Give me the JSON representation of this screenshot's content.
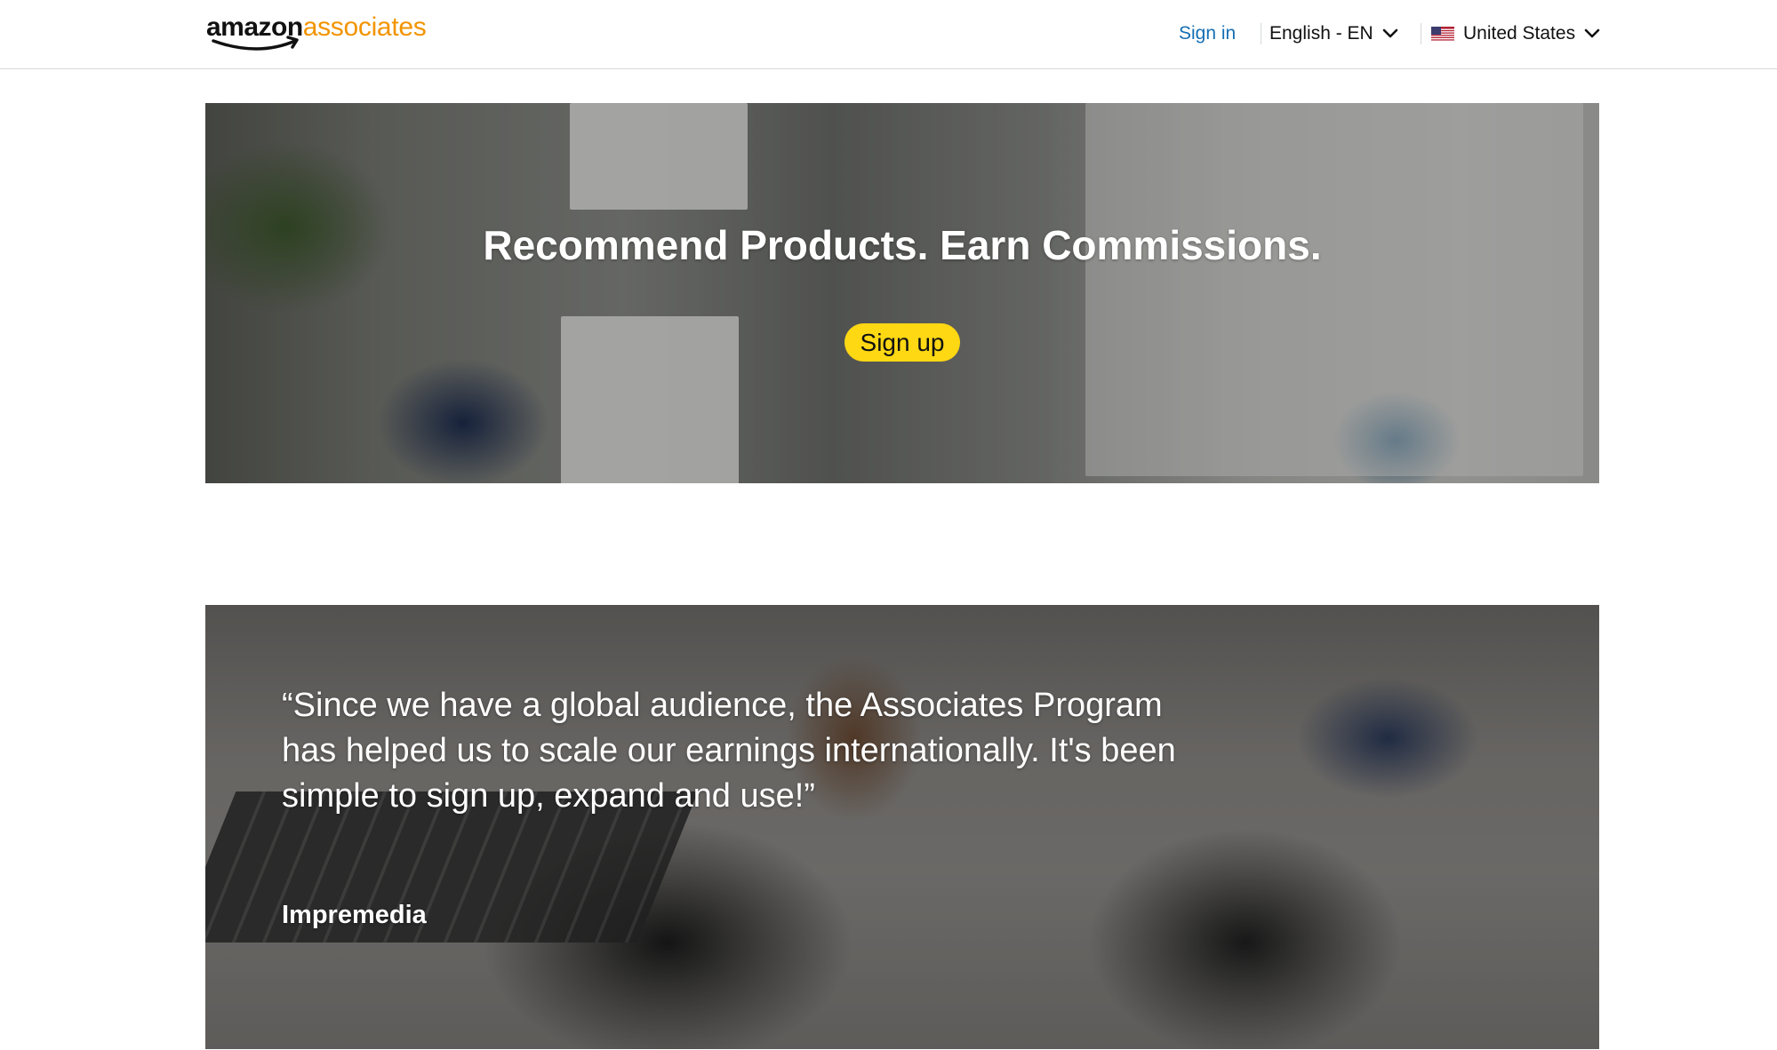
{
  "header": {
    "logo": {
      "word1": "amazon",
      "word2": "associates"
    },
    "sign_in": "Sign in",
    "language": "English - EN",
    "country": "United States"
  },
  "hero": {
    "title": "Recommend Products. Earn Commissions.",
    "cta": "Sign up"
  },
  "testimonial": {
    "quote": "“Since we have a global audience, the Associates Program has helped us to scale our earnings internationally. It's been simple to sign up, expand and use!”",
    "author": "Impremedia"
  },
  "colors": {
    "brand_orange": "#f29400",
    "link_blue": "#146eb4",
    "cta_yellow": "#ffd814"
  },
  "icons": [
    "chevron-down-icon",
    "us-flag-icon",
    "amazon-smile-icon"
  ]
}
